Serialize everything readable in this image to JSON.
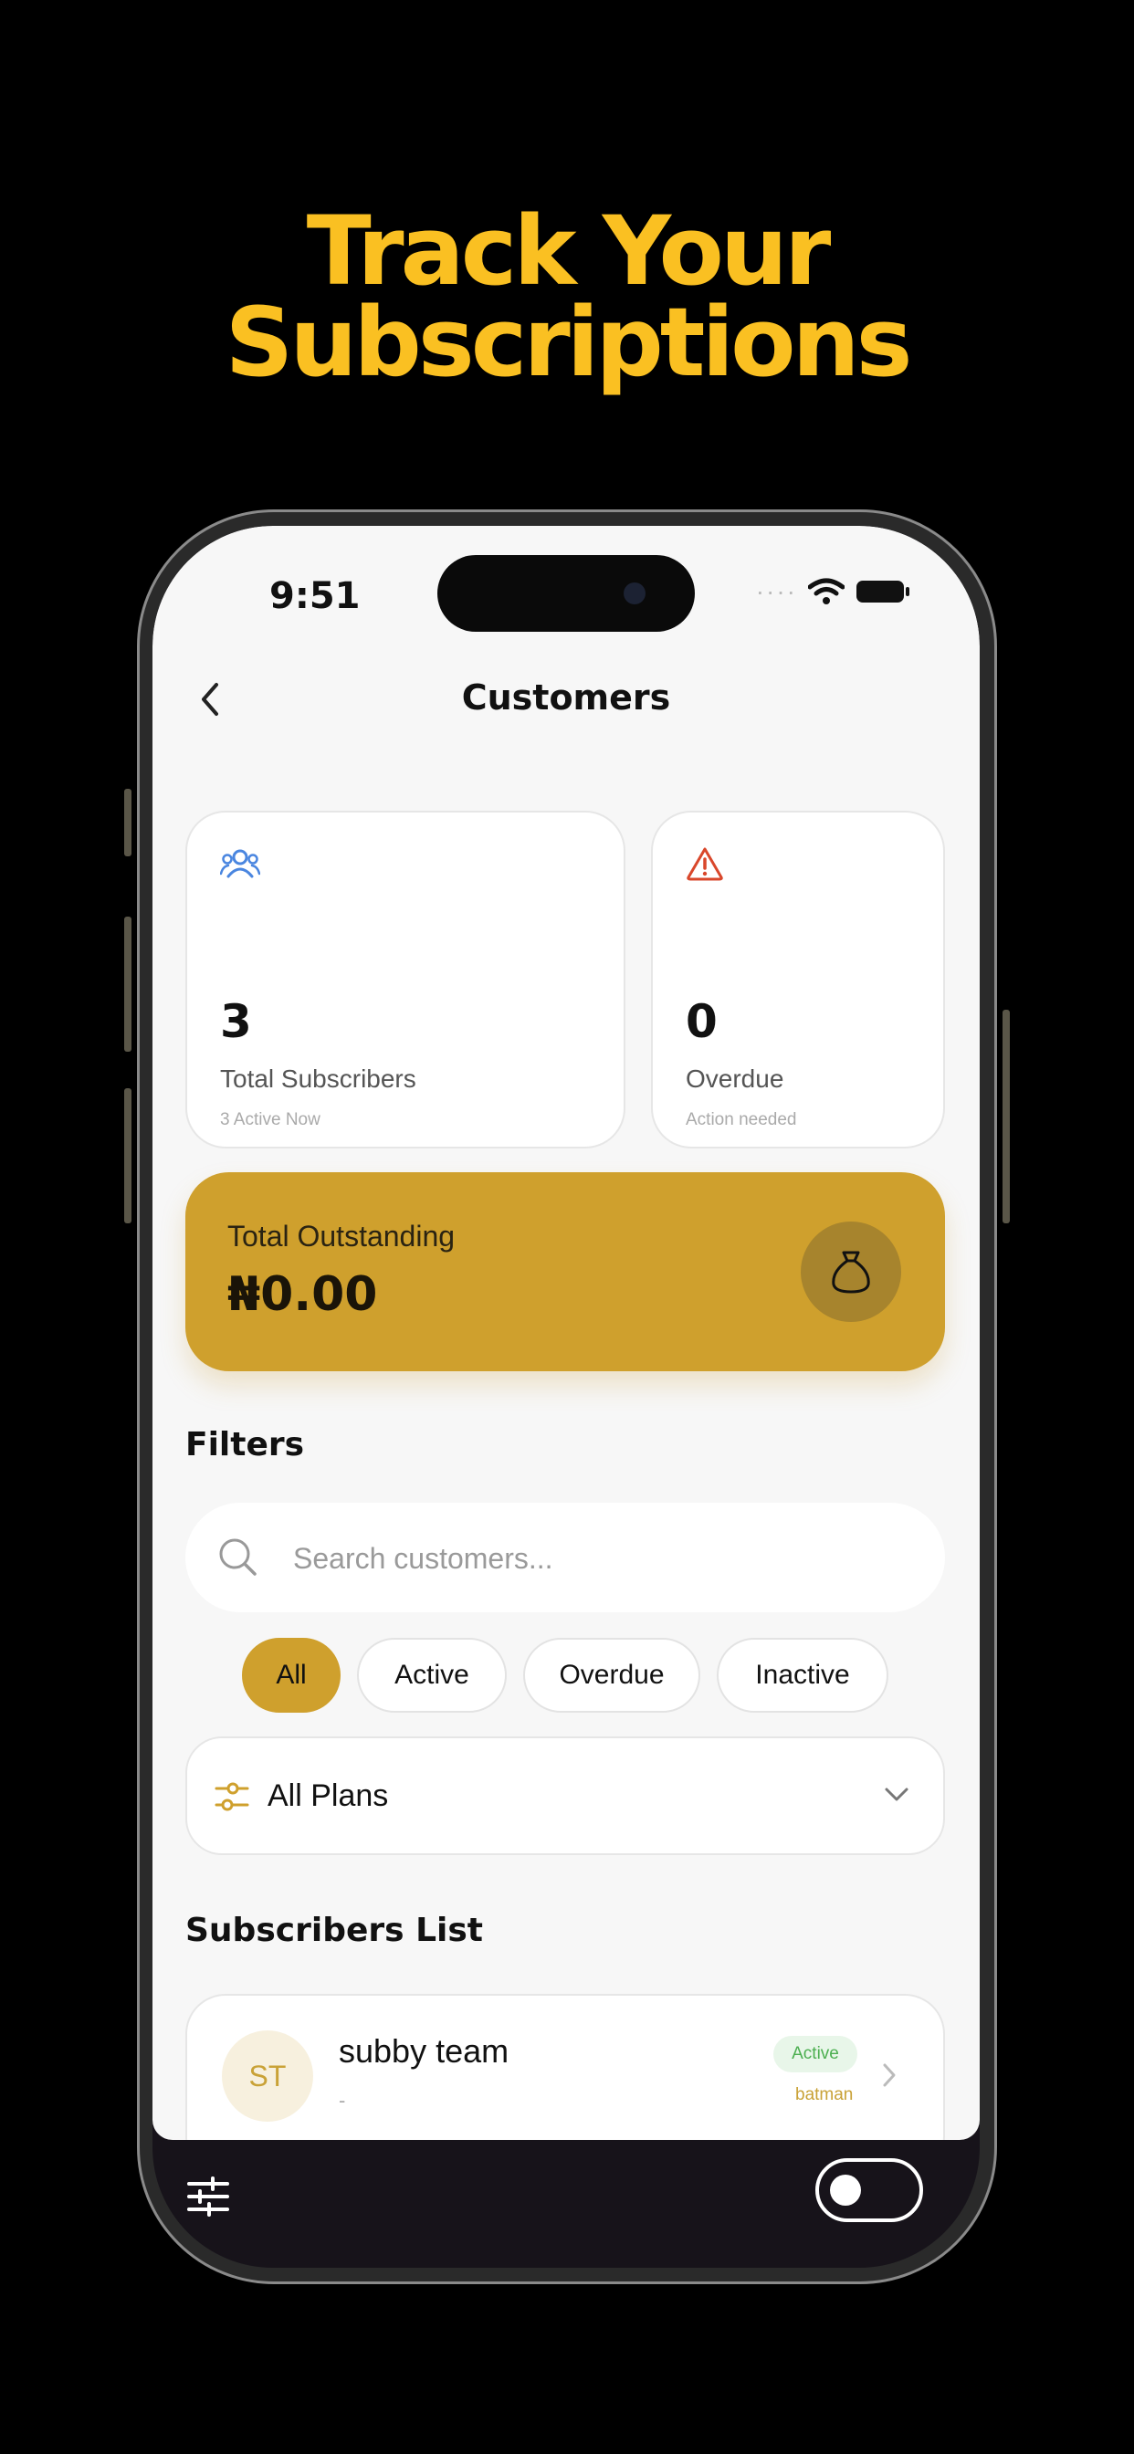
{
  "headline": {
    "line1": "Track Your",
    "line2": "Subscriptions"
  },
  "status_bar": {
    "time": "9:51"
  },
  "nav": {
    "title": "Customers"
  },
  "stats": {
    "total": {
      "value": "3",
      "label": "Total Subscribers",
      "sub": "3 Active Now",
      "icon": "users-icon"
    },
    "overdue": {
      "value": "0",
      "label": "Overdue",
      "sub": "Action needed",
      "icon": "alert-triangle-icon"
    }
  },
  "outstanding": {
    "label": "Total Outstanding",
    "value": "₦0.00",
    "icon": "money-bag-icon"
  },
  "filters": {
    "title": "Filters",
    "search_placeholder": "Search customers...",
    "chips": [
      "All",
      "Active",
      "Overdue",
      "Inactive"
    ],
    "selected_chip": "All",
    "plan_select": "All Plans"
  },
  "subscribers": {
    "title": "Subscribers List",
    "items": [
      {
        "initials": "ST",
        "name": "subby team",
        "detail": "-",
        "status": "Active",
        "plan": "batman"
      }
    ]
  },
  "colors": {
    "accent_gold": "#CFA02D",
    "headline_yellow": "#FAC022",
    "users_icon_blue": "#4A86E0",
    "alert_red": "#D9472B",
    "active_green": "#4CAF50"
  }
}
